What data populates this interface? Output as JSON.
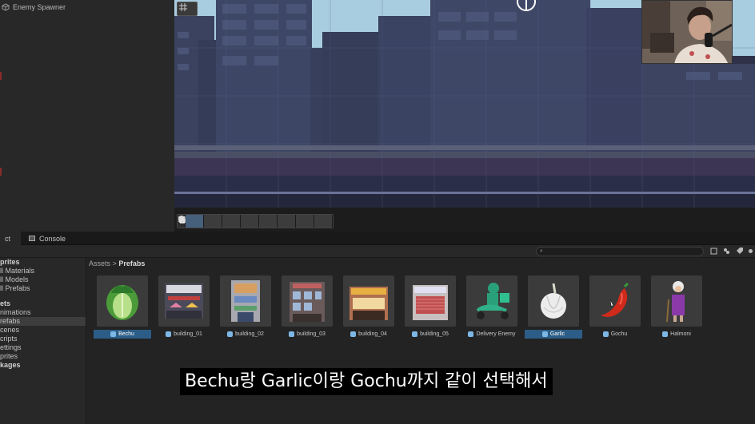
{
  "hierarchy": {
    "item_label": "Enemy Spawner"
  },
  "tabs": {
    "project_label": "ct",
    "console_label": "Console"
  },
  "tree": [
    {
      "label": "prites",
      "bold": true
    },
    {
      "label": "ll Materials"
    },
    {
      "label": "ll Models"
    },
    {
      "label": "ll Prefabs"
    },
    {
      "label": "ets",
      "bold": true
    },
    {
      "label": "nimations"
    },
    {
      "label": "refabs",
      "selected": true
    },
    {
      "label": "cenes"
    },
    {
      "label": "cripts"
    },
    {
      "label": "ettings"
    },
    {
      "label": "prites"
    },
    {
      "label": "kages",
      "bold": true
    }
  ],
  "breadcrumb": {
    "root": "Assets",
    "separator": ">",
    "current": "Prefabs"
  },
  "assets": [
    {
      "name": "Bechu",
      "icon": "cabbage-icon",
      "selected": true
    },
    {
      "name": "building_01",
      "icon": "building-01-icon",
      "selected": false
    },
    {
      "name": "building_02",
      "icon": "building-02-icon",
      "selected": false
    },
    {
      "name": "building_03",
      "icon": "building-03-icon",
      "selected": false
    },
    {
      "name": "building_04",
      "icon": "building-04-icon",
      "selected": false
    },
    {
      "name": "building_05",
      "icon": "building-05-icon",
      "selected": false
    },
    {
      "name": "Delivery Enemy",
      "icon": "scooter-rider-icon",
      "selected": false
    },
    {
      "name": "Garlic",
      "icon": "garlic-icon",
      "selected": true
    },
    {
      "name": "Gochu",
      "icon": "chili-pepper-icon",
      "selected": false
    },
    {
      "name": "Halmoni",
      "icon": "grandma-icon",
      "selected": false
    }
  ],
  "subtitle": "Bechu랑 Garlic이랑 Gochu까지 같이 선택해서",
  "colors": {
    "selection": "#2c5d87",
    "scene_sky": "#a9cde0",
    "scene_building": "#3c4462",
    "panel": "#282828"
  }
}
